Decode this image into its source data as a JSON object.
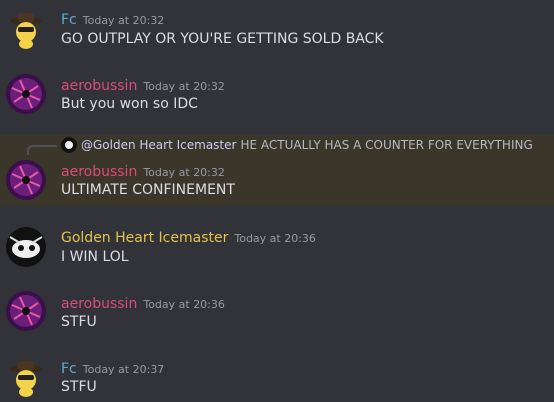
{
  "colors": {
    "background": "#313338",
    "fc": "#5fa8d3",
    "aerobussin": "#d94d77",
    "golden": "#e5c24e",
    "highlight": "#3a362a"
  },
  "messages": [
    {
      "author": "Fc",
      "time": "Today at 20:32",
      "text": "GO OUTPLAY OR YOU'RE GETTING SOLD BACK"
    },
    {
      "author": "aerobussin",
      "time": "Today at 20:32",
      "text": "But you won so IDC"
    },
    {
      "reply": {
        "mention": "@Golden Heart Icemaster",
        "text": "HE ACTUALLY HAS A COUNTER FOR EVERYTHING"
      },
      "author": "aerobussin",
      "time": "Today at 20:32",
      "text": "ULTIMATE CONFINEMENT"
    },
    {
      "author": "Golden Heart Icemaster",
      "time": "Today at 20:36",
      "text": "I WIN LOL"
    },
    {
      "author": "aerobussin",
      "time": "Today at 20:36",
      "text": "STFU"
    },
    {
      "author": "Fc",
      "time": "Today at 20:37",
      "text": "STFU"
    }
  ]
}
